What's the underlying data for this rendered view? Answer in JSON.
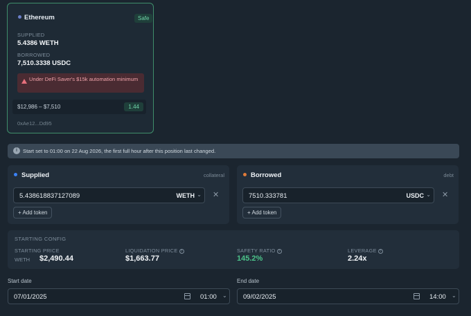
{
  "position": {
    "network": "Ethereum",
    "status": "Safe",
    "supplied_label": "SUPPLIED",
    "supplied_value": "5.4386 WETH",
    "borrowed_label": "BORROWED",
    "borrowed_value": "7,510.3338 USDC",
    "warning": "Under DeFi Saver's $15k automation minimum",
    "range": "$12,986 – $7,510",
    "ratio": "1.44",
    "address": "0xAe12...Dd95"
  },
  "banner": {
    "text": "Start set to 01:00 on 22 Aug 2026, the first full hour after this position last changed."
  },
  "supplied": {
    "title": "Supplied",
    "hint": "collateral",
    "amount": "5.438618837127089",
    "token": "WETH",
    "add_token": "+ Add token"
  },
  "borrowed": {
    "title": "Borrowed",
    "hint": "debt",
    "amount": "7510.333781",
    "token": "USDC",
    "add_token": "+ Add token"
  },
  "config": {
    "title": "STARTING CONFIG",
    "starting_price_label": "STARTING PRICE",
    "starting_price_asset": "WETH",
    "starting_price": "$2,490.44",
    "liquidation_label": "LIQUIDATION PRICE",
    "liquidation_price": "$1,663.77",
    "safety_label": "SAFETY RATIO",
    "safety_ratio": "145.2%",
    "leverage_label": "LEVERAGE",
    "leverage": "2.24x"
  },
  "dates": {
    "start_label": "Start date",
    "start_date": "07/01/2025",
    "start_time": "01:00",
    "end_label": "End date",
    "end_date": "09/02/2025",
    "end_time": "14:00"
  },
  "colors": {
    "safe": "#6fd3a8",
    "supplied_dot": "#3b82f6",
    "borrowed_dot": "#e07b39",
    "warning_bg": "#4a2b32"
  }
}
